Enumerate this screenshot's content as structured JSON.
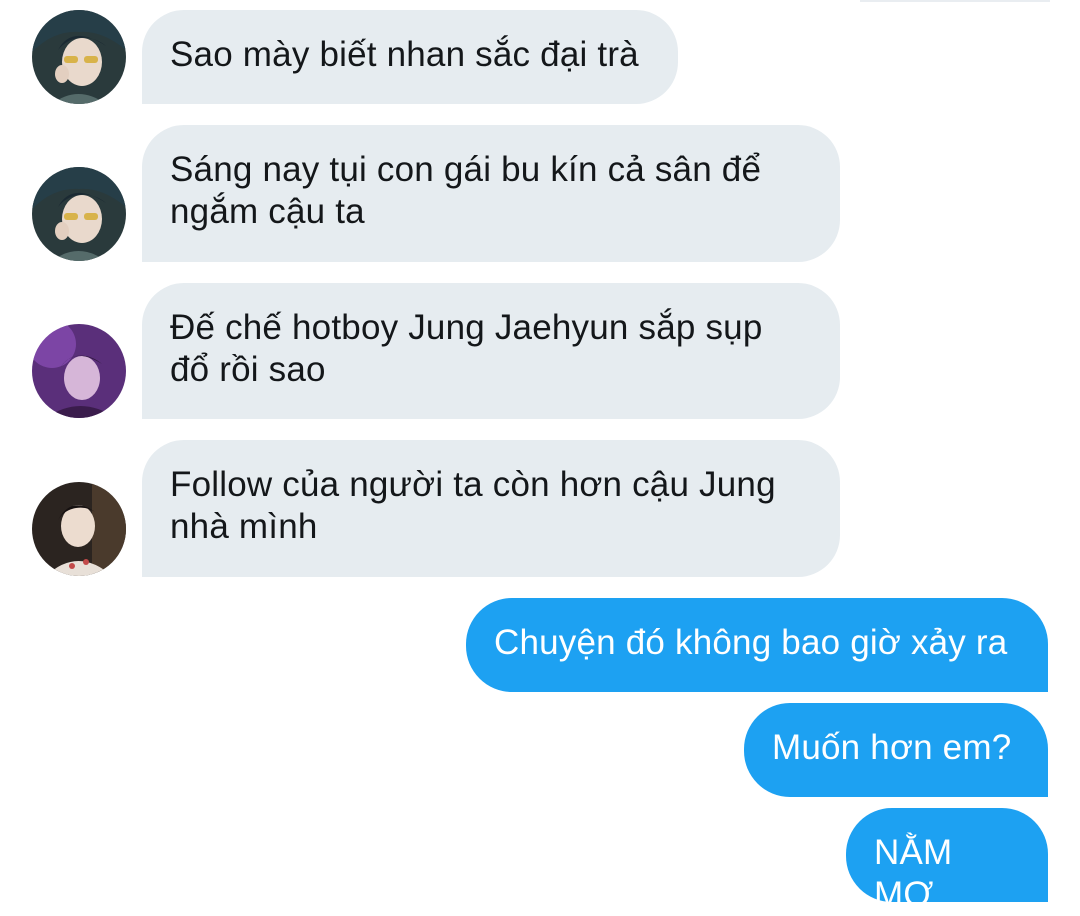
{
  "conversation": {
    "messages": [
      {
        "sender": "received",
        "avatar": "avatar-1-icon",
        "text": "Sao mày biết nhan sắc đại trà"
      },
      {
        "sender": "received",
        "avatar": "avatar-1-icon",
        "text": "Sáng nay tụi con gái bu kín cả sân để\nngắm cậu ta"
      },
      {
        "sender": "received",
        "avatar": "avatar-2-icon",
        "text": "Đế chế hotboy Jung Jaehyun sắp sụp\nđổ rồi sao"
      },
      {
        "sender": "received",
        "avatar": "avatar-3-icon",
        "text": "Follow của người ta còn hơn cậu Jung\nnhà mình"
      },
      {
        "sender": "sent",
        "text": "Chuyện đó không bao giờ xảy ra"
      },
      {
        "sender": "sent",
        "text": "Muốn hơn em?"
      },
      {
        "sender": "sent",
        "text": "NẰM MƠ"
      }
    ]
  },
  "colors": {
    "received_bubble": "#e6ecf0",
    "sent_bubble": "#1da1f2",
    "received_text": "#14171a",
    "sent_text": "#ffffff"
  }
}
